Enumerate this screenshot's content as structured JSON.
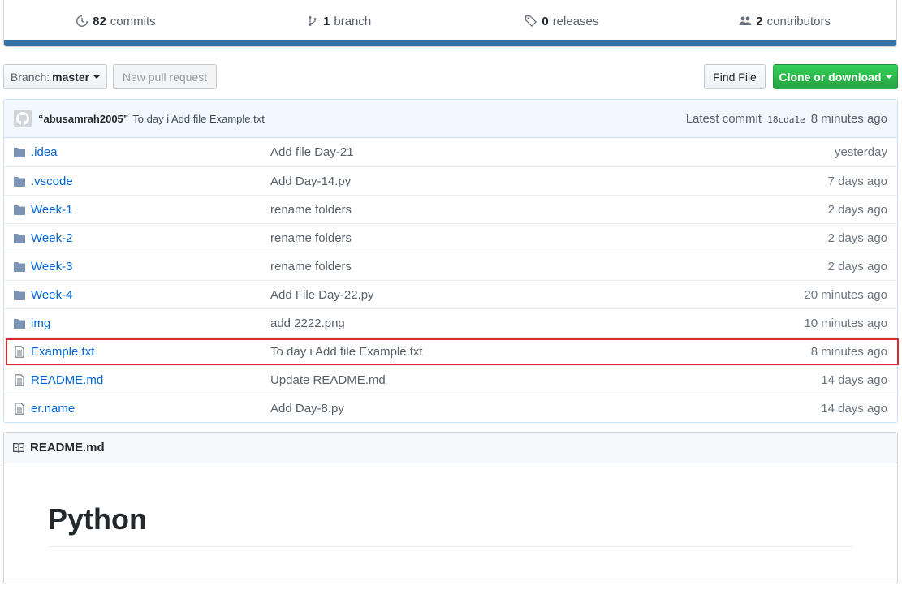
{
  "summary": {
    "commits_count": "82",
    "commits_label": "commits",
    "branch_count": "1",
    "branch_label": "branch",
    "releases_count": "0",
    "releases_label": "releases",
    "contributors_count": "2",
    "contributors_label": "contributors",
    "language_color": "#3572A5"
  },
  "toolbar": {
    "branch_prefix": "Branch:",
    "branch_name": "master",
    "new_pr_label": "New pull request",
    "find_file_label": "Find File",
    "clone_label": "Clone or download"
  },
  "commit": {
    "author": "“abusamrah2005”",
    "message": "To day i Add file Example.txt",
    "latest_label": "Latest commit",
    "sha": "18cda1e",
    "age": "8 minutes ago"
  },
  "files": [
    {
      "type": "folder",
      "name": ".idea",
      "message": "Add file Day-21",
      "age": "yesterday"
    },
    {
      "type": "folder",
      "name": ".vscode",
      "message": "Add Day-14.py",
      "age": "7 days ago"
    },
    {
      "type": "folder",
      "name": "Week-1",
      "message": "rename folders",
      "age": "2 days ago"
    },
    {
      "type": "folder",
      "name": "Week-2",
      "message": "rename folders",
      "age": "2 days ago"
    },
    {
      "type": "folder",
      "name": "Week-3",
      "message": "rename folders",
      "age": "2 days ago"
    },
    {
      "type": "folder",
      "name": "Week-4",
      "message": "Add File Day-22.py",
      "age": "20 minutes ago"
    },
    {
      "type": "folder",
      "name": "img",
      "message": "add 2222.png",
      "age": "10 minutes ago"
    },
    {
      "type": "file",
      "name": "Example.txt",
      "message": "To day i Add file Example.txt",
      "age": "8 minutes ago",
      "highlighted": true
    },
    {
      "type": "file",
      "name": "README.md",
      "message": "Update README.md",
      "age": "14 days ago"
    },
    {
      "type": "file",
      "name": "er.name",
      "message": "Add Day-8.py",
      "age": "14 days ago"
    }
  ],
  "readme": {
    "filename": "README.md",
    "heading": "Python"
  }
}
